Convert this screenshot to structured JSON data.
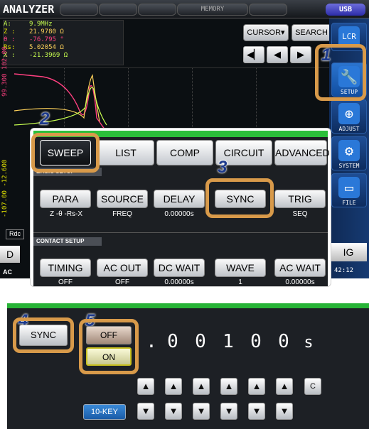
{
  "analyzer": {
    "title": "ANALYZER",
    "memory_label": "MEMORY",
    "usb_label": "USB",
    "readout": [
      {
        "key": "A:",
        "value": "9.9MHz"
      },
      {
        "key": "Z :",
        "value": "21.9780 Ω"
      },
      {
        "key": "θ :",
        "value": "-76.795 °"
      },
      {
        "key": "Rs:",
        "value": "5.02054 Ω"
      },
      {
        "key": "X :",
        "value": "-21.3969 Ω"
      }
    ],
    "cursor_label": "CURSOR▾",
    "search_label": "SEARCH",
    "axis_left_top": "99.300  102.00",
    "axis_left_bottom": "-107.00  -12.600",
    "side_labels": {
      "rdc": "Rdc",
      "d": "D",
      "ac": "AC",
      "g": "IG",
      "time": "42:12"
    }
  },
  "right_panel": {
    "lcr_label": "LCR",
    "setup_label": "SETUP",
    "adjust_label": "ADJUST",
    "system_label": "SYSTEM",
    "file_label": "FILE"
  },
  "setup": {
    "tabs": [
      {
        "label": "SWEEP",
        "active": true
      },
      {
        "label": "LIST",
        "active": false
      },
      {
        "label": "COMP",
        "active": false
      },
      {
        "label": "CIRCUIT",
        "active": false
      },
      {
        "label": "ADVANCED",
        "active": false
      }
    ],
    "basic_section": "BASIC SETUP",
    "contact_section": "CONTACT SETUP",
    "basic_params": [
      {
        "label": "PARA",
        "value": "Z -θ -Rs-X"
      },
      {
        "label": "SOURCE",
        "value": "FREQ"
      },
      {
        "label": "DELAY",
        "value": "0.00000s"
      },
      {
        "label": "SYNC",
        "value": ""
      },
      {
        "label": "TRIG",
        "value": "SEQ"
      }
    ],
    "contact_params": [
      {
        "label": "TIMING",
        "value": "OFF"
      },
      {
        "label": "AC OUT",
        "value": "OFF"
      },
      {
        "label": "DC WAIT",
        "value": "0.00000s"
      },
      {
        "label": "WAVE",
        "value": "1"
      },
      {
        "label": "AC WAIT",
        "value": "0.00000s"
      }
    ]
  },
  "bottom": {
    "sync_label": "SYNC",
    "off_label": "OFF",
    "on_label": "ON",
    "digits": [
      ".",
      "0",
      "0",
      "1",
      "0",
      "0",
      "s"
    ],
    "clear_label": "C",
    "tenkey_label": "10-KEY"
  },
  "steps": [
    "1",
    "2",
    "3",
    "4",
    "5"
  ],
  "colors": {
    "highlight": "#d89a4a",
    "step_number": "#1d3a8c",
    "green_bar": "#2bbf3a"
  }
}
